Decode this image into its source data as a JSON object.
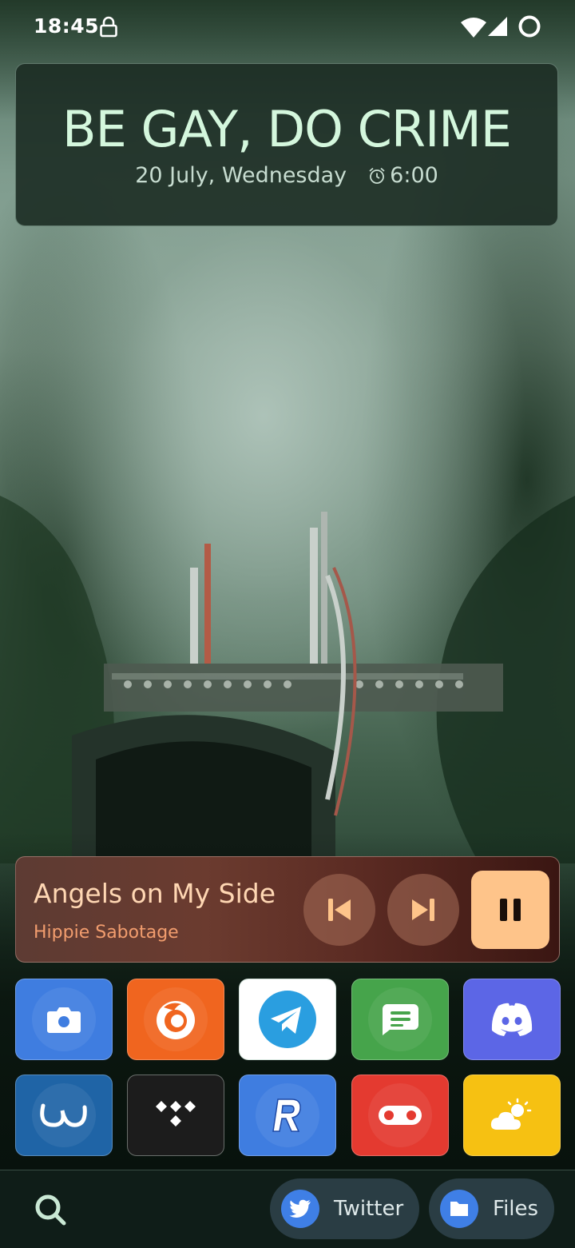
{
  "status_bar": {
    "time": "18:45"
  },
  "clock_widget": {
    "headline": "BE GAY, DO CRIME",
    "date": "20 July, Wednesday",
    "alarm": "6:00"
  },
  "media": {
    "title": "Angels on My Side",
    "artist": "Hippie Sabotage",
    "state": "playing"
  },
  "apps": [
    {
      "name": "camera",
      "color": "#3f7de0",
      "icon": "camera-icon"
    },
    {
      "name": "firefox",
      "color": "#f0651f",
      "icon": "firefox-icon"
    },
    {
      "name": "telegram",
      "color": "#ffffff",
      "icon": "telegram-icon"
    },
    {
      "name": "messages",
      "color": "#46a44b",
      "icon": "chat-bubble-icon"
    },
    {
      "name": "discord",
      "color": "#5c66e6",
      "icon": "discord-icon"
    },
    {
      "name": "wave",
      "color": "#1f64a6",
      "icon": "wave-icon"
    },
    {
      "name": "tidal",
      "color": "#1c1c1c",
      "icon": "tidal-icon"
    },
    {
      "name": "revolut",
      "color": "#3f7de0",
      "icon": "revolut-icon"
    },
    {
      "name": "voicemail",
      "color": "#e43a30",
      "icon": "voicemail-icon"
    },
    {
      "name": "weather",
      "color": "#f6c112",
      "icon": "weather-icon"
    }
  ],
  "dock": {
    "shortcuts": [
      {
        "label": "Twitter",
        "icon": "twitter-icon"
      },
      {
        "label": "Files",
        "icon": "folder-icon"
      }
    ]
  }
}
